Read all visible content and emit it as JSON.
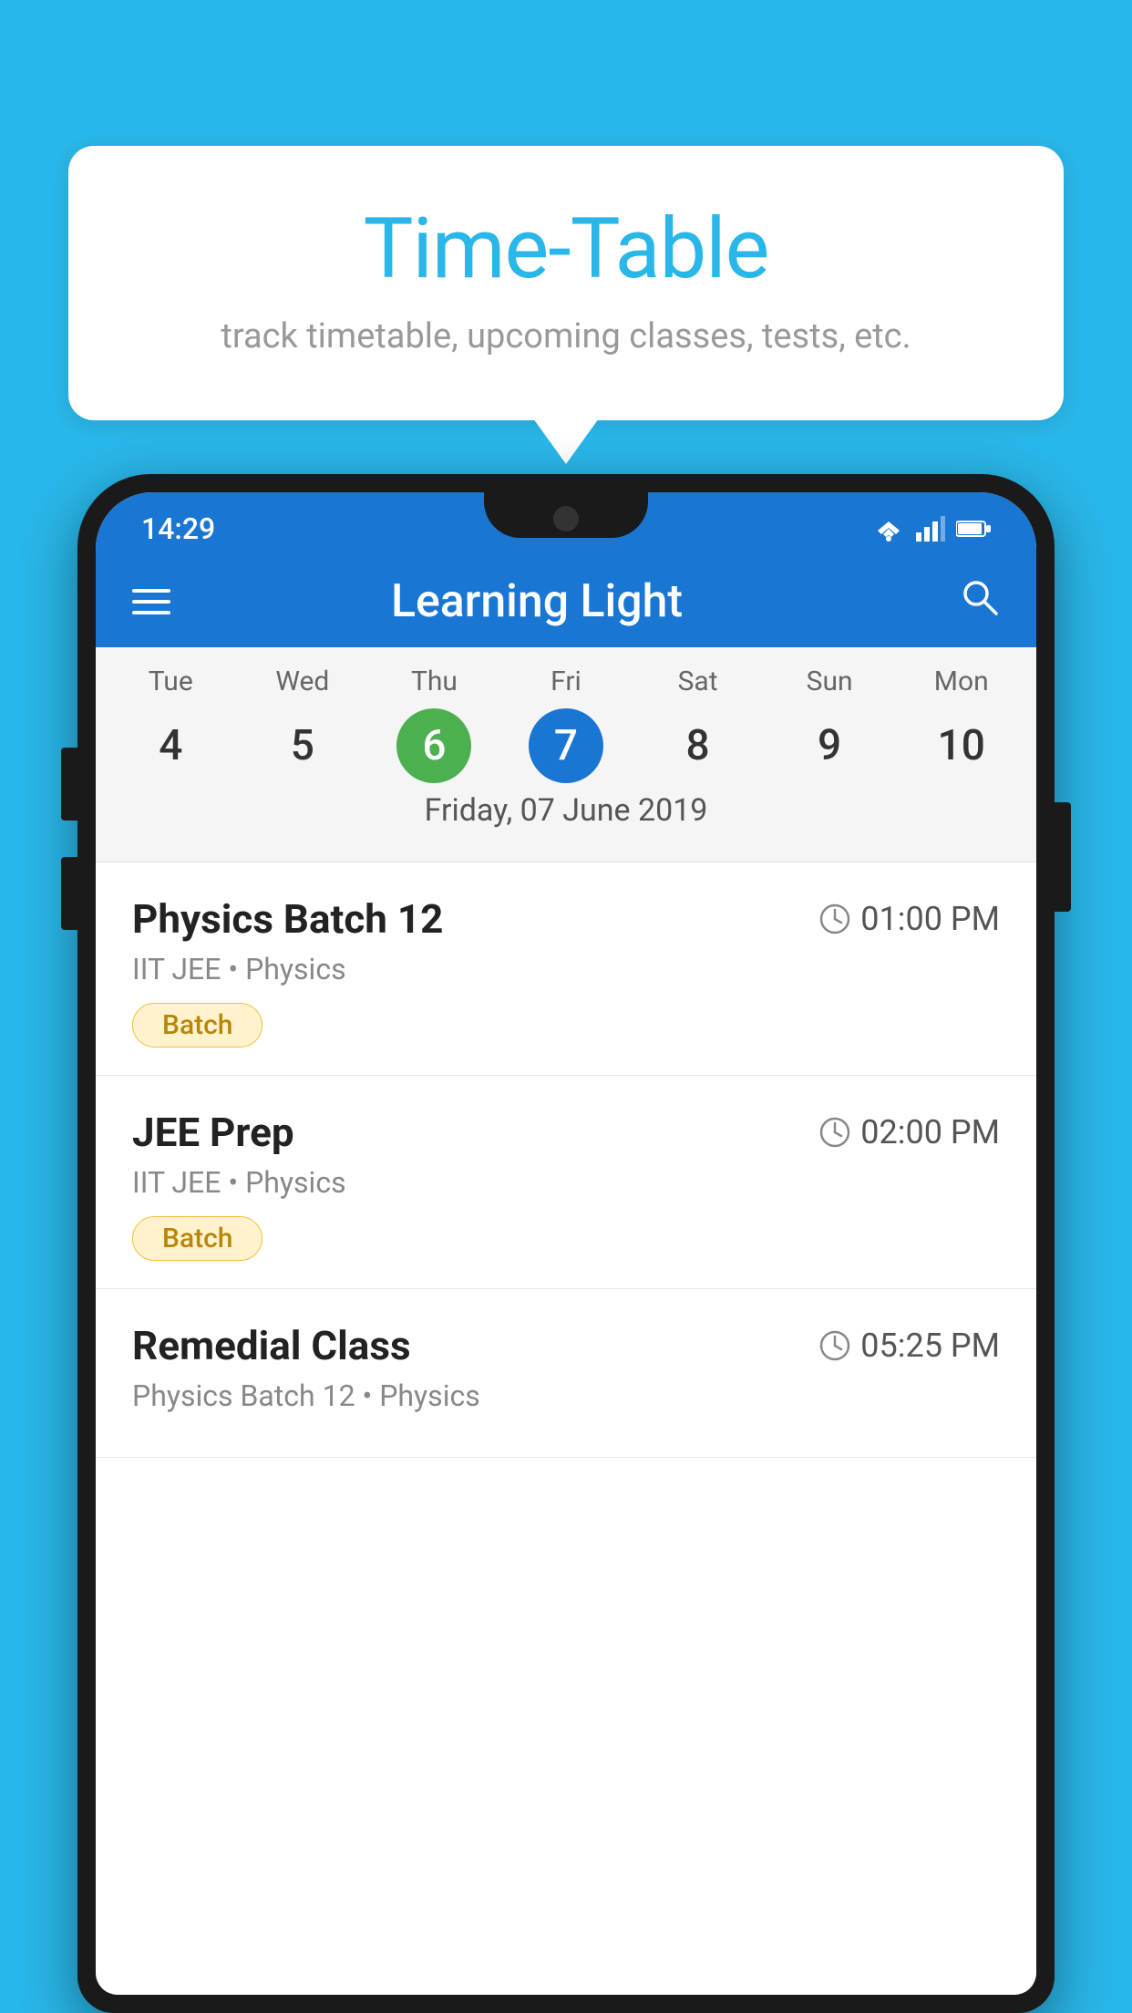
{
  "page": {
    "background_color": "#29b6e8"
  },
  "speech_bubble": {
    "title": "Time-Table",
    "subtitle": "track timetable, upcoming classes, tests, etc."
  },
  "app": {
    "title": "Learning Light",
    "status_time": "14:29"
  },
  "calendar": {
    "days": [
      {
        "label": "Tue",
        "number": "4",
        "state": "normal"
      },
      {
        "label": "Wed",
        "number": "5",
        "state": "normal"
      },
      {
        "label": "Thu",
        "number": "6",
        "state": "today"
      },
      {
        "label": "Fri",
        "number": "7",
        "state": "selected"
      },
      {
        "label": "Sat",
        "number": "8",
        "state": "normal"
      },
      {
        "label": "Sun",
        "number": "9",
        "state": "normal"
      },
      {
        "label": "Mon",
        "number": "10",
        "state": "normal"
      }
    ],
    "selected_date": "Friday, 07 June 2019"
  },
  "classes": [
    {
      "name": "Physics Batch 12",
      "time": "01:00 PM",
      "meta": "IIT JEE • Physics",
      "badge": "Batch"
    },
    {
      "name": "JEE Prep",
      "time": "02:00 PM",
      "meta": "IIT JEE • Physics",
      "badge": "Batch"
    },
    {
      "name": "Remedial Class",
      "time": "05:25 PM",
      "meta": "Physics Batch 12 • Physics",
      "badge": ""
    }
  ],
  "icons": {
    "menu": "☰",
    "search": "🔍",
    "clock": "⏱"
  }
}
